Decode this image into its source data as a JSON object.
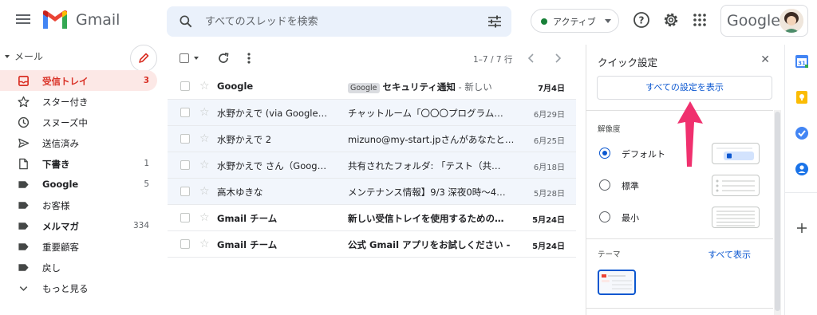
{
  "header": {
    "brand": "Gmail",
    "search_placeholder": "すべてのスレッドを検索",
    "status": "アクティブ",
    "account_brand": "Google"
  },
  "sidebar": {
    "section": "メール",
    "items": [
      {
        "label": "受信トレイ",
        "count": "3",
        "icon": "inbox-icon"
      },
      {
        "label": "スター付き",
        "count": "",
        "icon": "star-icon"
      },
      {
        "label": "スヌーズ中",
        "count": "",
        "icon": "clock-icon"
      },
      {
        "label": "送信済み",
        "count": "",
        "icon": "send-icon"
      },
      {
        "label": "下書き",
        "count": "1",
        "icon": "draft-icon"
      },
      {
        "label": "Google",
        "count": "5",
        "icon": "label-icon"
      },
      {
        "label": "お客様",
        "count": "",
        "icon": "label-icon"
      },
      {
        "label": "メルマガ",
        "count": "334",
        "icon": "label-icon"
      },
      {
        "label": "重要顧客",
        "count": "",
        "icon": "label-icon"
      },
      {
        "label": "戻し",
        "count": "",
        "icon": "label-icon"
      },
      {
        "label": "もっと見る",
        "count": "",
        "icon": "chevron-down-icon"
      }
    ]
  },
  "toolbar": {
    "range": "1–7 / 7 行"
  },
  "emails": [
    {
      "from": "Google",
      "tag": "Google",
      "subject": "セキュリティ通知",
      "snippet": " - 新しい",
      "date": "7月4日",
      "unread": true
    },
    {
      "from": "水野かえで (via Google C.",
      "tag": "",
      "subject": "チャットルーム「〇〇〇プログラム…",
      "snippet": "",
      "date": "6月29日",
      "unread": false
    },
    {
      "from": "水野かえで 2",
      "tag": "",
      "subject": "mizuno@my-start.jpさんがあなたと…",
      "snippet": "",
      "date": "6月25日",
      "unread": false
    },
    {
      "from": "水野かえで さん（Googl…",
      "tag": "",
      "subject": "共有されたフォルダ: 「テスト（共…",
      "snippet": "",
      "date": "6月18日",
      "unread": false
    },
    {
      "from": "高木ゆきな",
      "tag": "",
      "subject": "メンテナンス情報】9/3 深夜0時〜4…",
      "snippet": "",
      "date": "5月28日",
      "unread": false
    },
    {
      "from": "Gmail チーム",
      "tag": "",
      "subject": "新しい受信トレイを使用するための…",
      "snippet": "",
      "date": "5月24日",
      "unread": true
    },
    {
      "from": "Gmail チーム",
      "tag": "",
      "subject": "公式 Gmail アプリをお試しください -",
      "snippet": "",
      "date": "5月24日",
      "unread": true
    }
  ],
  "quick_settings": {
    "title": "クイック設定",
    "all_settings": "すべての設定を表示",
    "density_label": "解像度",
    "density_options": [
      "デフォルト",
      "標準",
      "最小"
    ],
    "selected_density": "デフォルト",
    "theme_label": "テーマ",
    "theme_link": "すべて表示"
  },
  "colors": {
    "accent_red": "#d93025",
    "link_blue": "#0b57d0",
    "arrow_pink": "#f0306e",
    "active_bg": "#fce8e6"
  }
}
